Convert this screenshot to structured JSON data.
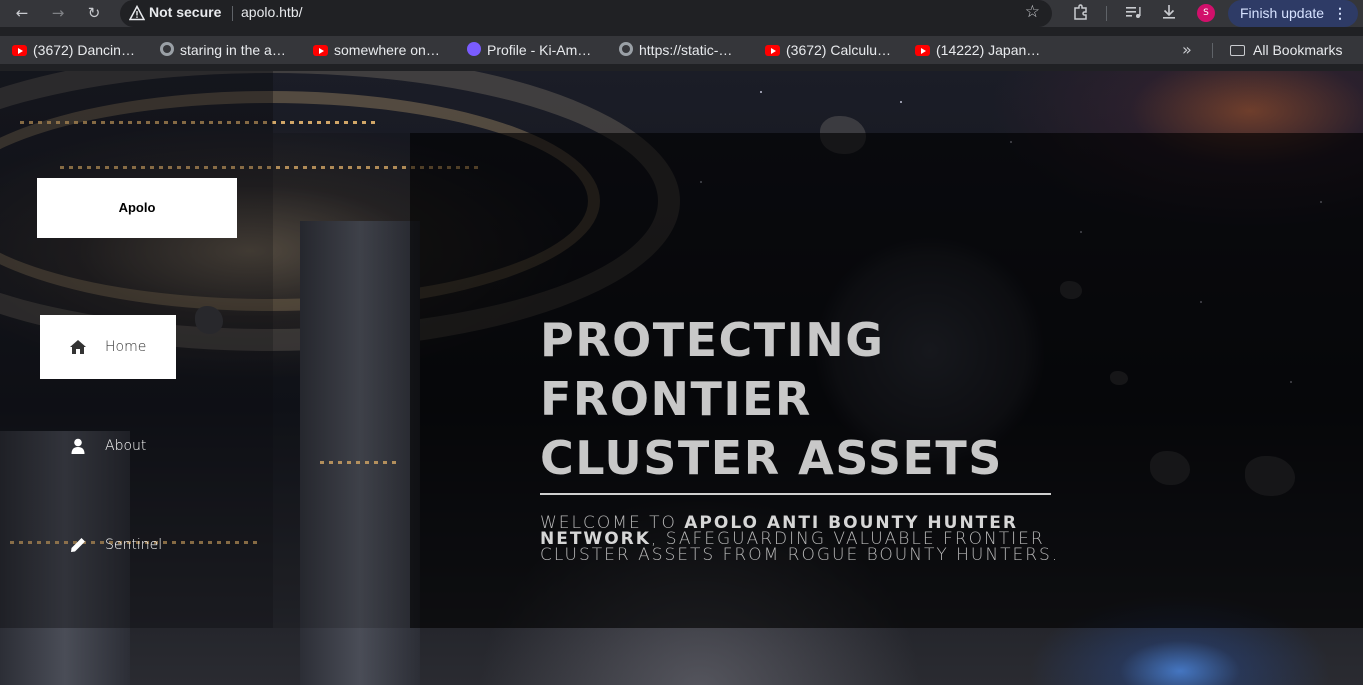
{
  "browser": {
    "security_label": "Not secure",
    "url": "apolo.htb/",
    "update_button_label": "Finish update",
    "profile_initial": "S",
    "bookmarks": [
      {
        "label": "(3672) Dancin…",
        "icon": "youtube-icon"
      },
      {
        "label": "staring in the a…",
        "icon": "globe-icon"
      },
      {
        "label": "somewhere on…",
        "icon": "youtube-icon"
      },
      {
        "label": "Profile - Ki-Am…",
        "icon": "ki-icon"
      },
      {
        "label": "https://static-…",
        "icon": "globe-icon"
      },
      {
        "label": "(3672) Calculu…",
        "icon": "youtube-icon"
      },
      {
        "label": "(14222) Japan…",
        "icon": "youtube-icon"
      }
    ],
    "all_bookmarks_label": "All Bookmarks"
  },
  "site": {
    "logo_text": "Apolo",
    "nav": [
      {
        "label": "Home",
        "icon": "home-icon",
        "active": true
      },
      {
        "label": "About",
        "icon": "user-icon",
        "active": false
      },
      {
        "label": "Sentinel",
        "icon": "pencil-icon",
        "active": false
      }
    ],
    "hero": {
      "title": "PROTECTING FRONTIER CLUSTER ASSETS",
      "subtitle_prefix": "WELCOME TO ",
      "subtitle_bold": "APOLO ANTI BOUNTY HUNTER NETWORK",
      "subtitle_rest": ", SAFEGUARDING VALUABLE FRONTIER CLUSTER ASSETS FROM ROGUE BOUNTY HUNTERS."
    }
  },
  "colors": {
    "chrome_bg": "#35363a",
    "omnibox_bg": "#202124",
    "update_button_bg": "#2e3b66",
    "active_nav_bg": "#ffffff",
    "hero_text": "#c8c8c8"
  }
}
